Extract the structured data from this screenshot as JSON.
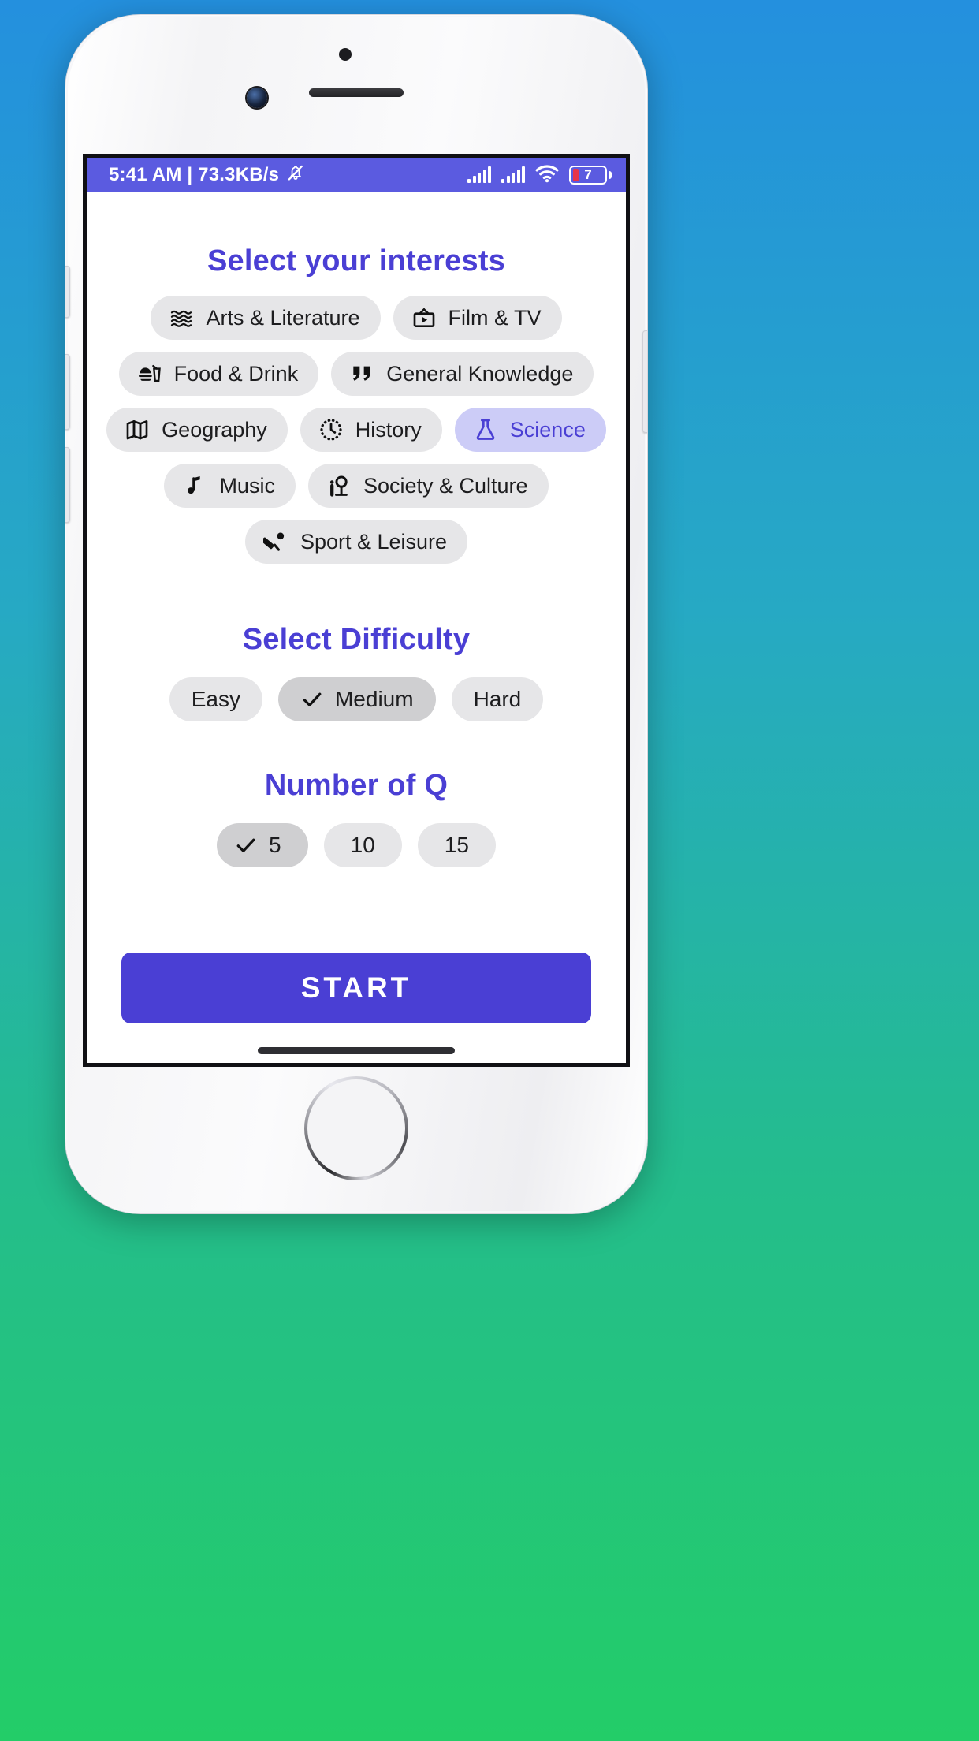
{
  "colors": {
    "accent": "#4a3fd4",
    "status_bar": "#5b5be0",
    "chip_bg": "#e6e6e8",
    "chip_selected_bg": "#ccccf7",
    "pill_selected_bg": "#cfcfd1",
    "battery_level": "#e8344a",
    "bg_gradient_top": "#2490de",
    "bg_gradient_bottom": "#23cd68"
  },
  "status_bar": {
    "left_text": "5:41 AM | 73.3KB/s",
    "mute_icon": "bell-muted-icon",
    "signal_1_icon": "signal-bars-icon",
    "signal_2_icon": "signal-bars-icon",
    "wifi_icon": "wifi-icon",
    "battery_icon": "battery-icon",
    "battery_level": "7"
  },
  "interests": {
    "title": "Select your interests",
    "rows": [
      [
        {
          "label": "Arts & Literature",
          "icon": "waves-icon",
          "selected": false
        },
        {
          "label": "Film & TV",
          "icon": "tv-icon",
          "selected": false
        }
      ],
      [
        {
          "label": "Food & Drink",
          "icon": "burger-drink-icon",
          "selected": false
        },
        {
          "label": "General Knowledge",
          "icon": "quotes-icon",
          "selected": false
        }
      ],
      [
        {
          "label": "Geography",
          "icon": "map-icon",
          "selected": false
        },
        {
          "label": "History",
          "icon": "clock-dotted-icon",
          "selected": false
        },
        {
          "label": "Science",
          "icon": "flask-icon",
          "selected": true
        }
      ],
      [
        {
          "label": "Music",
          "icon": "music-note-icon",
          "selected": false
        },
        {
          "label": "Society & Culture",
          "icon": "person-podium-icon",
          "selected": false
        }
      ],
      [
        {
          "label": "Sport & Leisure",
          "icon": "cricket-bat-ball-icon",
          "selected": false
        }
      ]
    ]
  },
  "difficulty": {
    "title": "Select Difficulty",
    "options": [
      {
        "label": "Easy",
        "selected": false
      },
      {
        "label": "Medium",
        "selected": true
      },
      {
        "label": "Hard",
        "selected": false
      }
    ]
  },
  "number_of_questions": {
    "title": "Number of Q",
    "options": [
      {
        "label": "5",
        "selected": true
      },
      {
        "label": "10",
        "selected": false
      },
      {
        "label": "15",
        "selected": false
      }
    ]
  },
  "start": {
    "label": "START"
  }
}
